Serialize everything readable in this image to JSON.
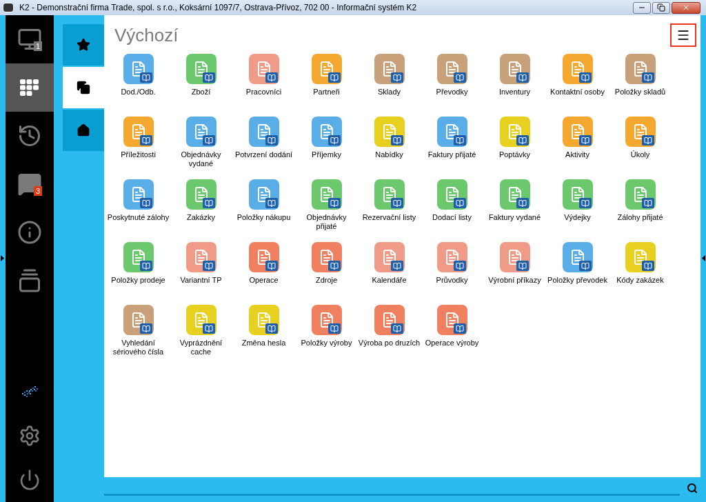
{
  "window": {
    "title": "K2 - Demonstrační firma Trade, spol. s r.o., Koksární 1097/7, Ostrava-Přívoz, 702 00 - Informační systém K2"
  },
  "sidebar": {
    "items": [
      {
        "kind": "monitor",
        "badge": "1",
        "selected": false
      },
      {
        "kind": "grid",
        "selected": true
      },
      {
        "kind": "history",
        "selected": false
      },
      {
        "kind": "chat",
        "badge": "3",
        "selected": false
      },
      {
        "kind": "info",
        "selected": false
      },
      {
        "kind": "video",
        "selected": false
      }
    ],
    "bottom_items": [
      {
        "kind": "logo"
      },
      {
        "kind": "settings"
      },
      {
        "kind": "power"
      }
    ]
  },
  "tabs": [
    {
      "kind": "star",
      "selected": false
    },
    {
      "kind": "copy",
      "selected": true
    },
    {
      "kind": "home",
      "selected": false
    }
  ],
  "page": {
    "title": "Výchozí",
    "tiles": [
      {
        "label": "Dod./Odb.",
        "color": "#5aaee8"
      },
      {
        "label": "Zboží",
        "color": "#6cc86c"
      },
      {
        "label": "Pracovníci",
        "color": "#f09a88"
      },
      {
        "label": "Partneři",
        "color": "#f5a830"
      },
      {
        "label": "Sklady",
        "color": "#c8a07a"
      },
      {
        "label": "Převodky",
        "color": "#c8a07a"
      },
      {
        "label": "Inventury",
        "color": "#c8a07a"
      },
      {
        "label": "Kontaktní osoby",
        "color": "#f5a830"
      },
      {
        "label": "Položky skladů",
        "color": "#c8a07a"
      },
      {
        "label": "Příležitosti",
        "color": "#f5a830"
      },
      {
        "label": "Objednávky vydané",
        "color": "#5aaee8"
      },
      {
        "label": "Potvrzení dodání",
        "color": "#5aaee8"
      },
      {
        "label": "Příjemky",
        "color": "#5aaee8"
      },
      {
        "label": "Nabídky",
        "color": "#e8d020"
      },
      {
        "label": "Faktury přijaté",
        "color": "#5aaee8"
      },
      {
        "label": "Poptávky",
        "color": "#e8d020"
      },
      {
        "label": "Aktivity",
        "color": "#f5a830"
      },
      {
        "label": "Úkoly",
        "color": "#f5a830"
      },
      {
        "label": "Poskytnuté zálohy",
        "color": "#5aaee8"
      },
      {
        "label": "Zakázky",
        "color": "#6cc86c"
      },
      {
        "label": "Položky nákupu",
        "color": "#5aaee8"
      },
      {
        "label": "Objednávky přijaté",
        "color": "#6cc86c"
      },
      {
        "label": "Rezervační listy",
        "color": "#6cc86c"
      },
      {
        "label": "Dodací listy",
        "color": "#6cc86c"
      },
      {
        "label": "Faktury vydané",
        "color": "#6cc86c"
      },
      {
        "label": "Výdejky",
        "color": "#6cc86c"
      },
      {
        "label": "Zálohy přijaté",
        "color": "#6cc86c"
      },
      {
        "label": "Položky prodeje",
        "color": "#6cc86c"
      },
      {
        "label": "Variantní TP",
        "color": "#f09a88"
      },
      {
        "label": "Operace",
        "color": "#f08060"
      },
      {
        "label": "Zdroje",
        "color": "#f08060"
      },
      {
        "label": "Kalendáře",
        "color": "#f09a88"
      },
      {
        "label": "Průvodky",
        "color": "#f09a88"
      },
      {
        "label": "Výrobní příkazy",
        "color": "#f09a88"
      },
      {
        "label": "Položky převodek",
        "color": "#5aaee8"
      },
      {
        "label": "Kódy zakázek",
        "color": "#e8d020"
      },
      {
        "label": "Vyhledání sériového čísla",
        "color": "#c8a07a"
      },
      {
        "label": "Vyprázdnění cache",
        "color": "#e8d020"
      },
      {
        "label": "Změna hesla",
        "color": "#e8d020"
      },
      {
        "label": "Položky výroby",
        "color": "#f08060"
      },
      {
        "label": "Výroba po druzích",
        "color": "#f08060"
      },
      {
        "label": "Operace výroby",
        "color": "#f08060"
      }
    ]
  }
}
